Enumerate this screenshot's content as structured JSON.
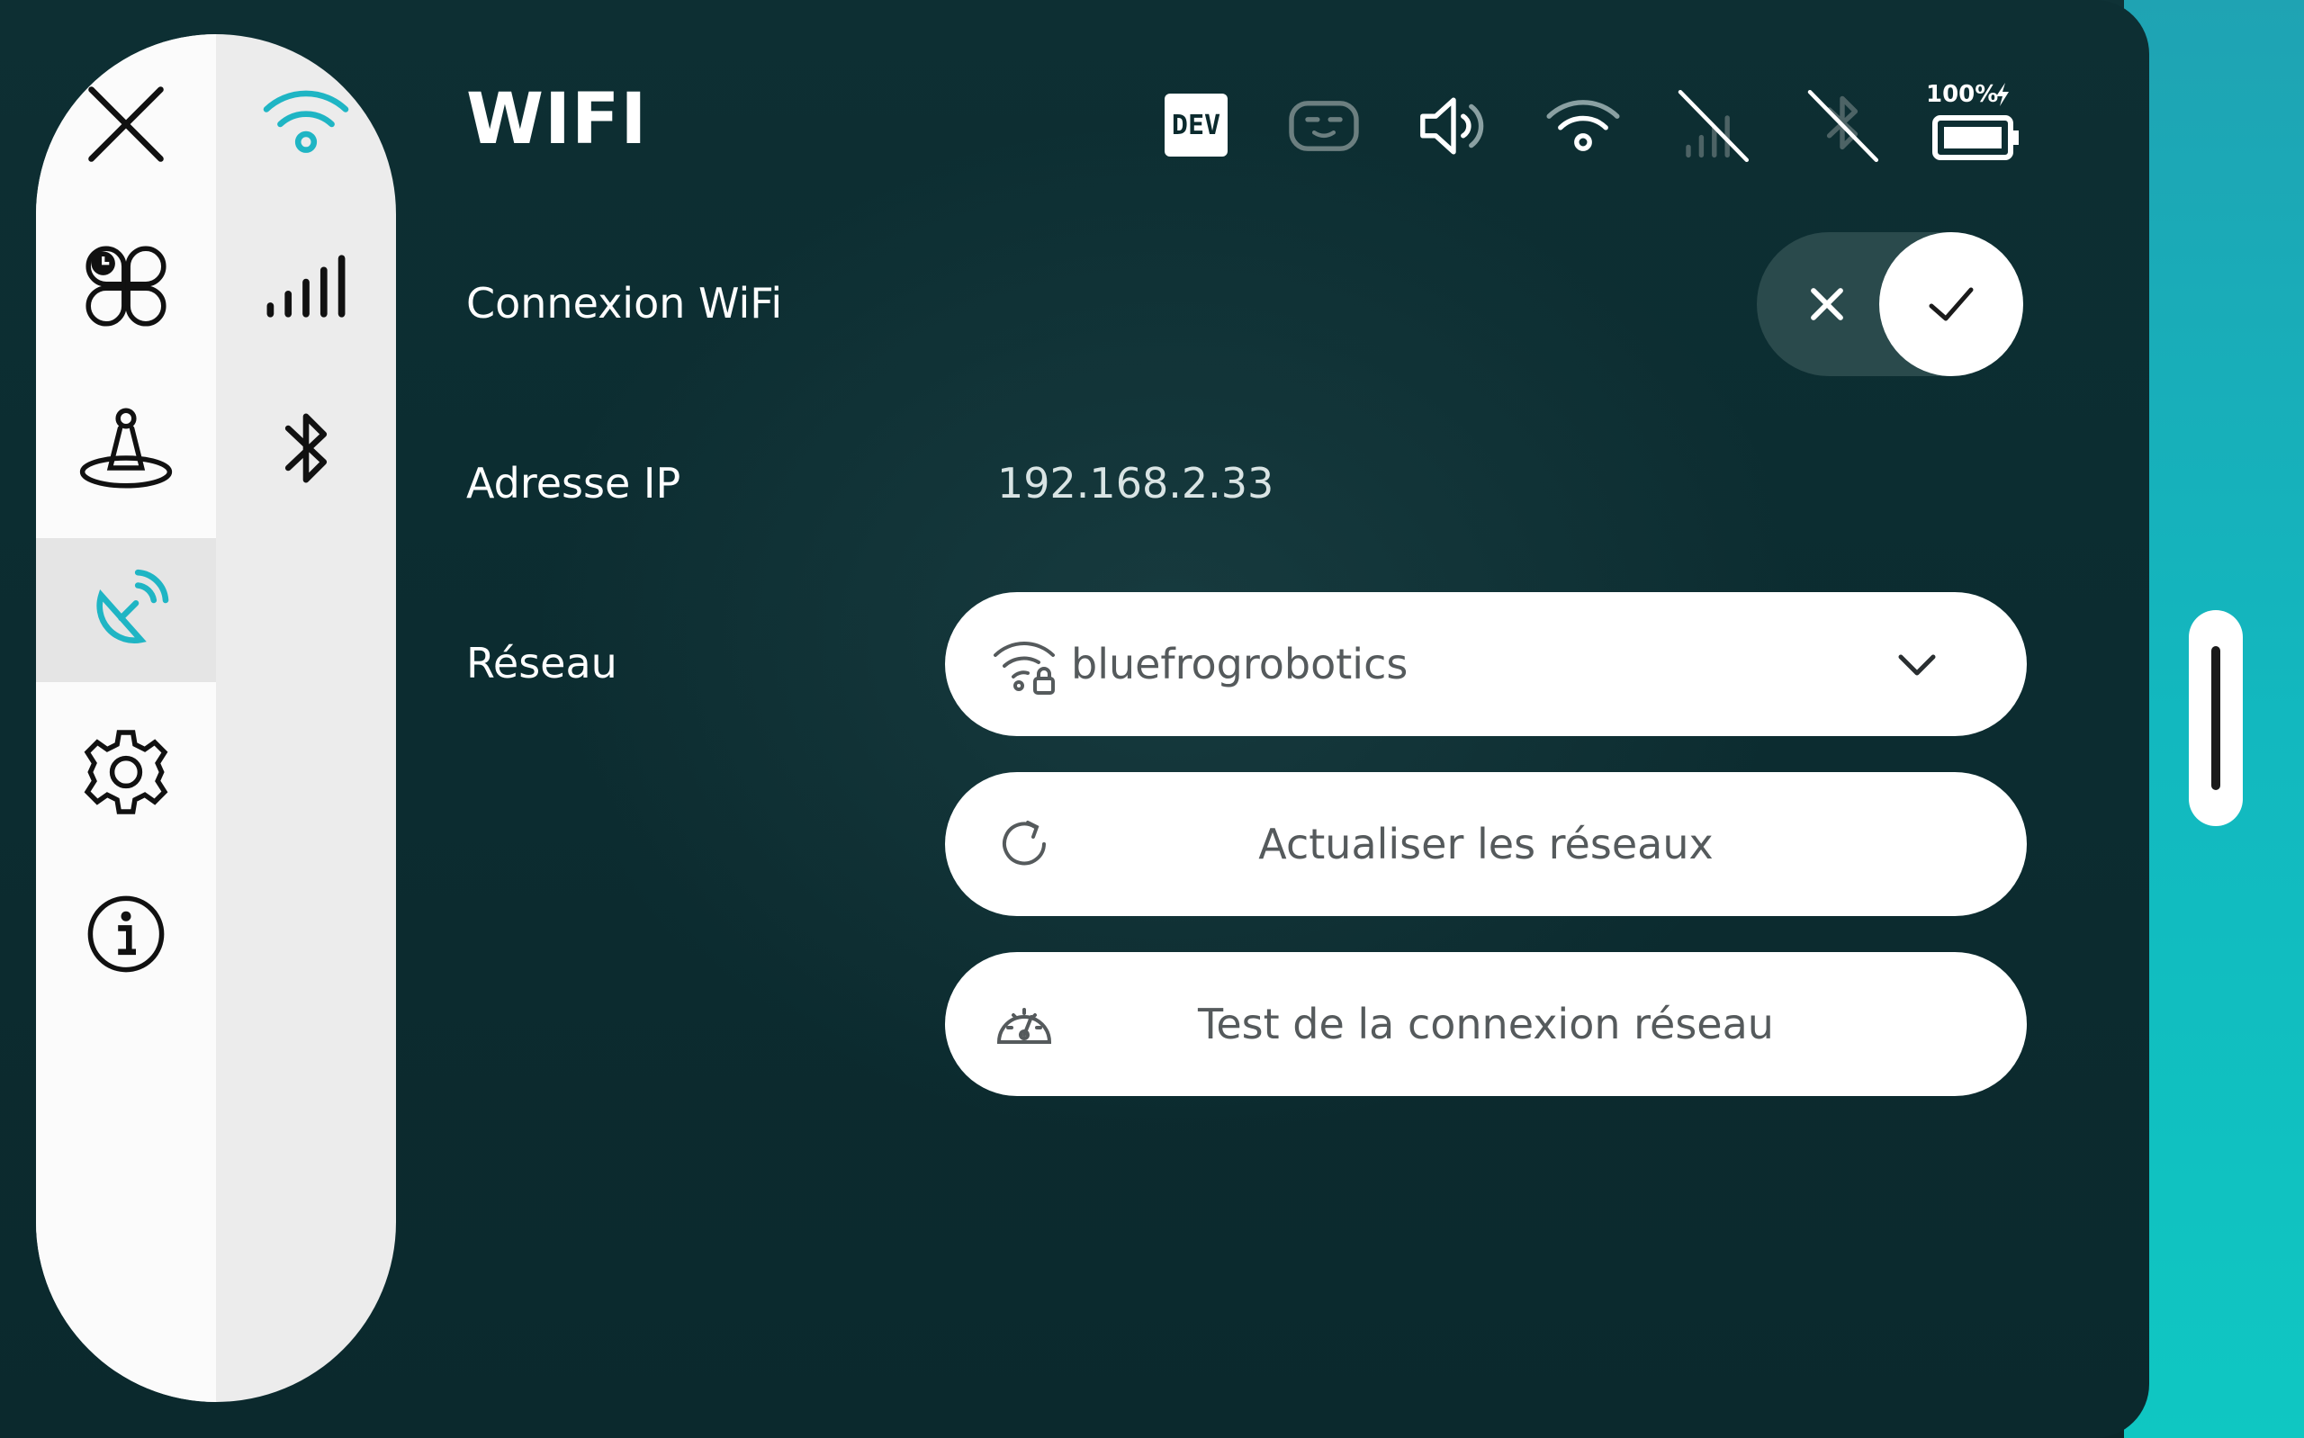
{
  "header": {
    "title": "WIFI",
    "dev_badge": "DEV",
    "battery_percent": "100%"
  },
  "settings": {
    "wifi_connection_label": "Connexion WiFi",
    "wifi_enabled": true,
    "ip_label": "Adresse IP",
    "ip_value": "192.168.2.33",
    "network_label": "Réseau",
    "selected_network": "bluefrogrobotics",
    "refresh_label": "Actualiser les réseaux",
    "test_label": "Test de la connexion réseau"
  },
  "sidebar": {
    "primary": [
      "close-icon",
      "apps-icon",
      "robot-joystick-icon",
      "satellite-dish-icon",
      "gear-icon",
      "info-icon"
    ],
    "secondary": [
      "wifi-icon",
      "cellular-signal-icon",
      "bluetooth-icon"
    ]
  },
  "colors": {
    "accent": "#1fb5c4",
    "panel": "#0b2a2d",
    "sidebar": "#ececec"
  }
}
